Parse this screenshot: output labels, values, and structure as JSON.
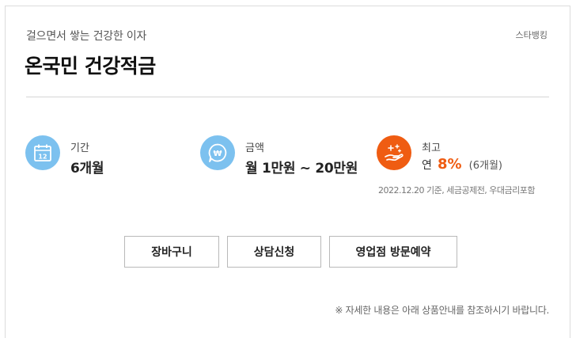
{
  "header": {
    "subtitle": "걸으면서 쌓는 건강한 이자",
    "provider": "스타뱅킹",
    "title": "온국민 건강적금"
  },
  "info": {
    "period": {
      "icon": "calendar-icon",
      "label": "기간",
      "value": "6개월"
    },
    "amount": {
      "icon": "won-chat-icon",
      "label": "금액",
      "value": "월 1만원 ~ 20만원"
    },
    "rate": {
      "icon": "hand-sparkle-icon",
      "label": "최고",
      "prefix": "연",
      "value": "8%",
      "period": "(6개월)",
      "note": "2022.12.20 기준, 세금공제전, 우대금리포함"
    }
  },
  "actions": {
    "cart": "장바구니",
    "consult": "상담신청",
    "branch_visit": "영업점 방문예약"
  },
  "footnote": "※ 자세한 내용은 아래 상품안내를 참조하시기 바랍니다.",
  "colors": {
    "blue_icon": "#7cc1ef",
    "accent_orange": "#ef5c12"
  }
}
